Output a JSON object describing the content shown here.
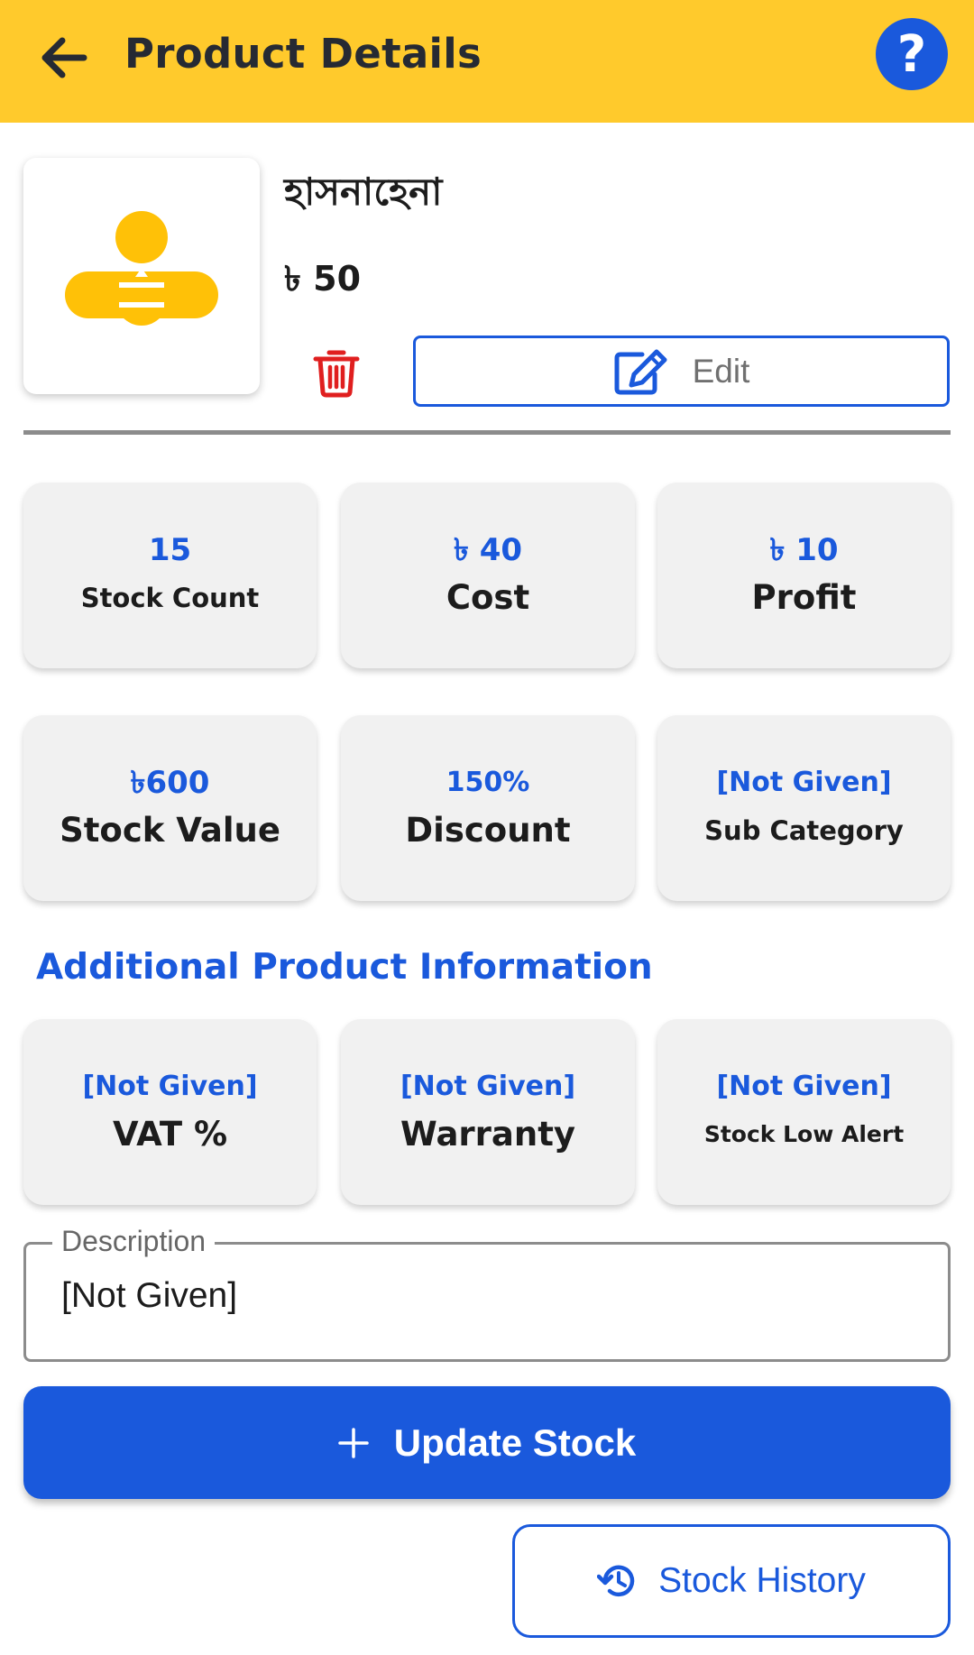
{
  "header": {
    "title": "Product Details",
    "help_label": "?"
  },
  "product": {
    "name": "হাসনাহেনা",
    "price": "৳ 50",
    "edit_label": "Edit"
  },
  "stats": [
    {
      "value": "15",
      "label": "Stock Count"
    },
    {
      "value": "৳ 40",
      "label": "Cost"
    },
    {
      "value": "৳ 10",
      "label": "Profit"
    },
    {
      "value": "৳600",
      "label": "Stock Value"
    },
    {
      "value": "150%",
      "label": "Discount"
    },
    {
      "value": "[Not Given]",
      "label": "Sub Category"
    }
  ],
  "additional": {
    "title": "Additional Product Information",
    "items": [
      {
        "value": "[Not Given]",
        "label": "VAT %"
      },
      {
        "value": "[Not Given]",
        "label": "Warranty"
      },
      {
        "value": "[Not Given]",
        "label": "Stock Low Alert"
      }
    ]
  },
  "description": {
    "legend": "Description",
    "value": "[Not Given]"
  },
  "actions": {
    "update_stock": "Update Stock",
    "stock_history": "Stock History"
  },
  "colors": {
    "header_bg": "#FFCA2C",
    "primary": "#1A59DC",
    "delete": "#E01F1F",
    "logo": "#FFC107"
  }
}
